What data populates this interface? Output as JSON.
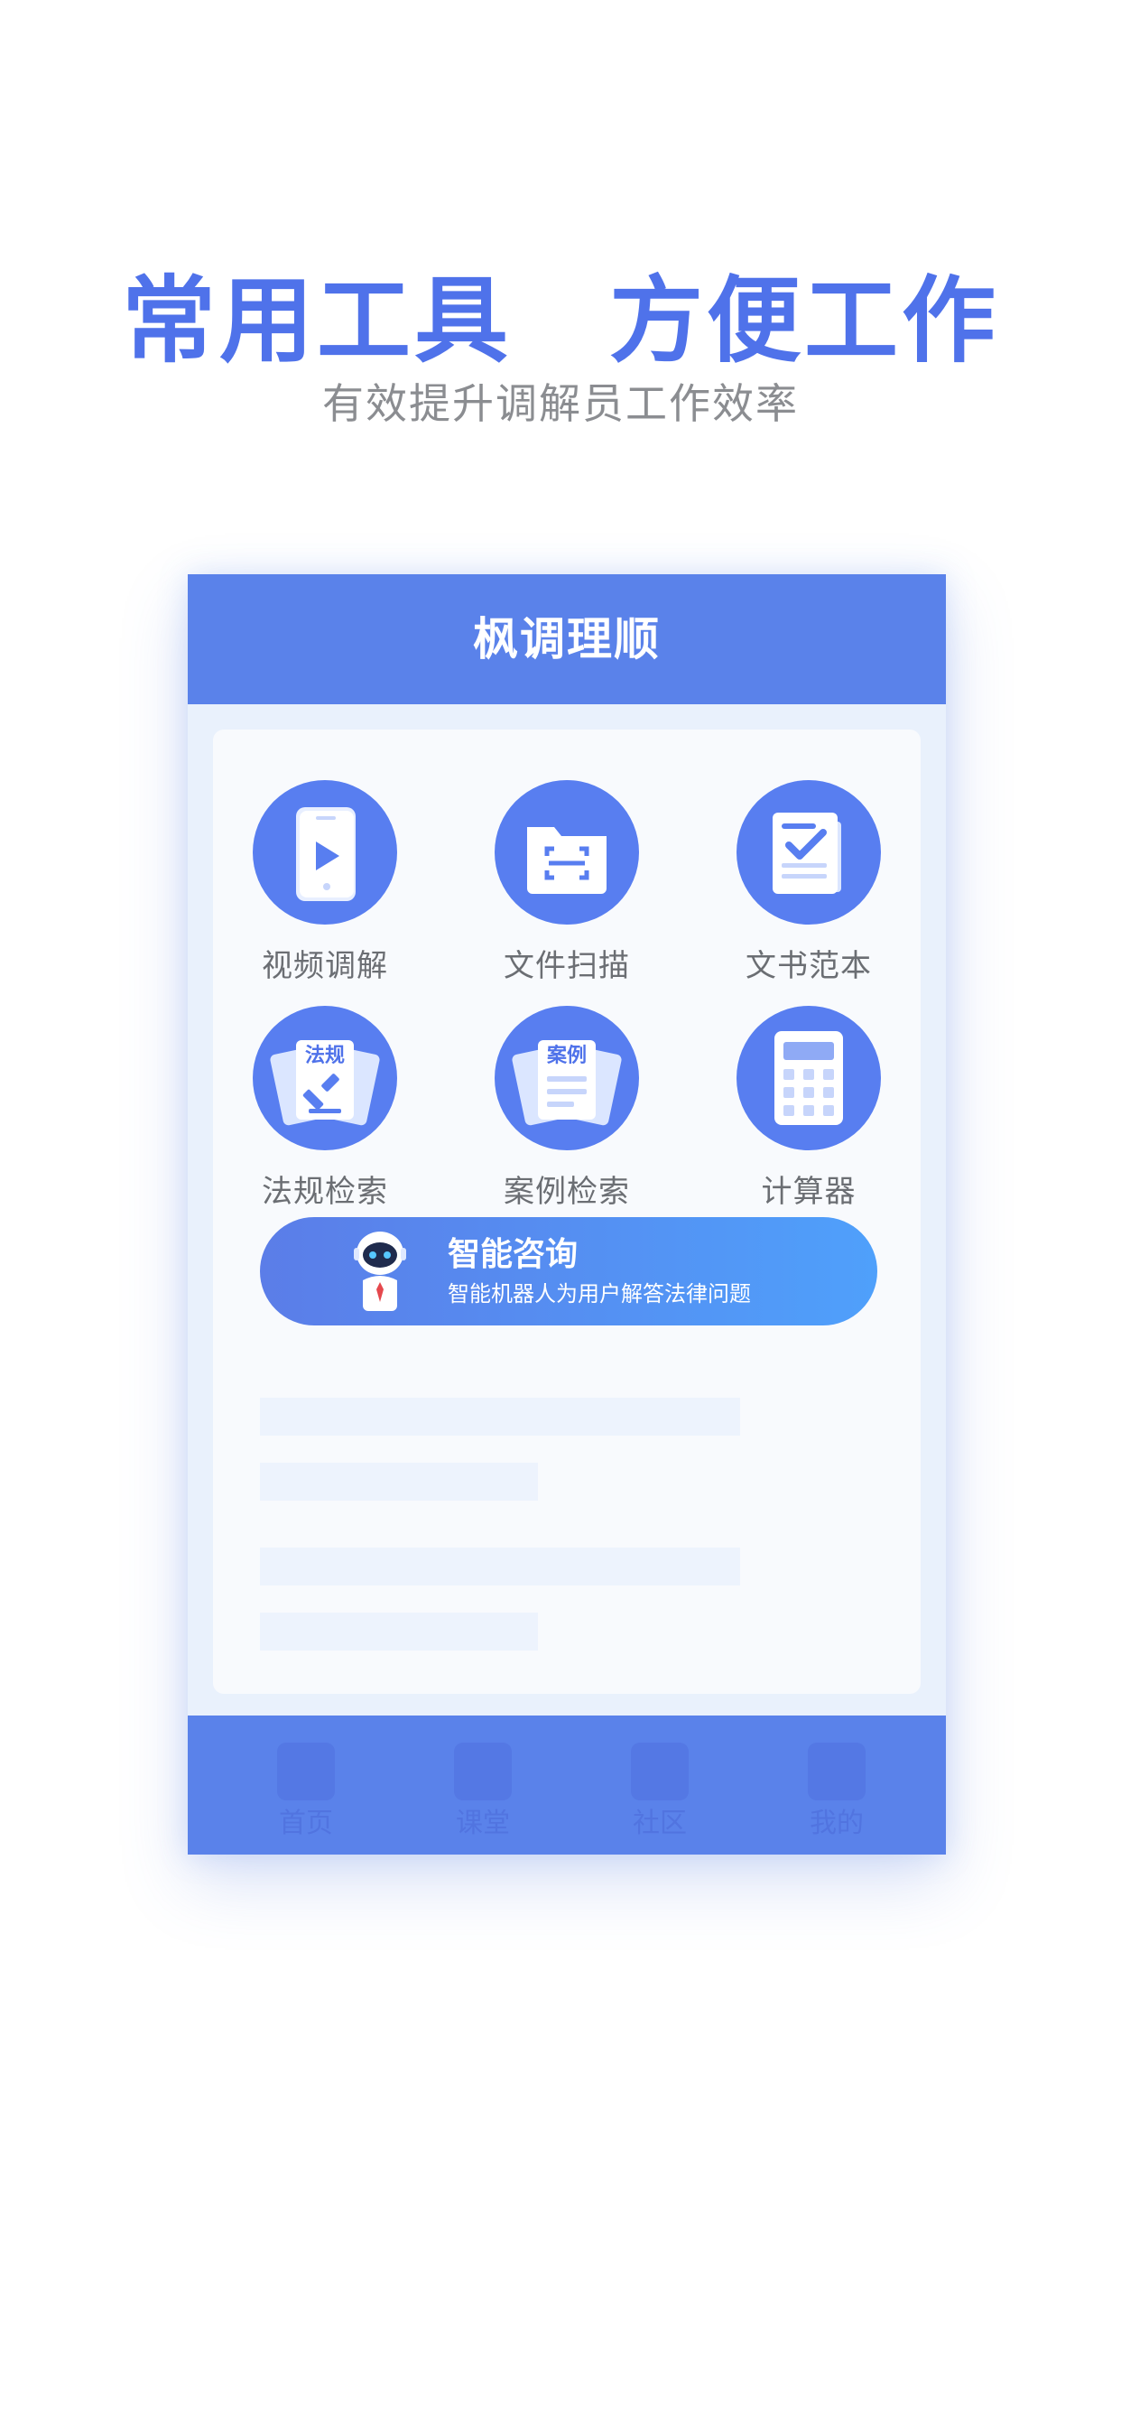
{
  "hero": {
    "headline": "常用工具　方便工作",
    "subheadline": "有效提升调解员工作效率"
  },
  "app": {
    "title": "枫调理顺",
    "tools": [
      {
        "label": "视频调解",
        "icon": "video-phone-icon"
      },
      {
        "label": "文件扫描",
        "icon": "folder-scan-icon"
      },
      {
        "label": "文书范本",
        "icon": "document-check-icon"
      },
      {
        "label": "法规检索",
        "icon": "law-gavel-icon",
        "badge": "法规"
      },
      {
        "label": "案例检索",
        "icon": "case-document-icon",
        "badge": "案例"
      },
      {
        "label": "计算器",
        "icon": "calculator-icon"
      }
    ],
    "consult": {
      "title": "智能咨询",
      "description": "智能机器人为用户解答法律问题",
      "icon": "robot-icon"
    },
    "tabbar": [
      {
        "label": "首页"
      },
      {
        "label": "课堂"
      },
      {
        "label": "社区"
      },
      {
        "label": "我的"
      }
    ]
  },
  "colors": {
    "brand": "#4f72ea",
    "header": "#5a82ea",
    "icon_circle": "#587ef0",
    "gradient_start": "#5b7de8",
    "gradient_end": "#4fa0fb"
  }
}
